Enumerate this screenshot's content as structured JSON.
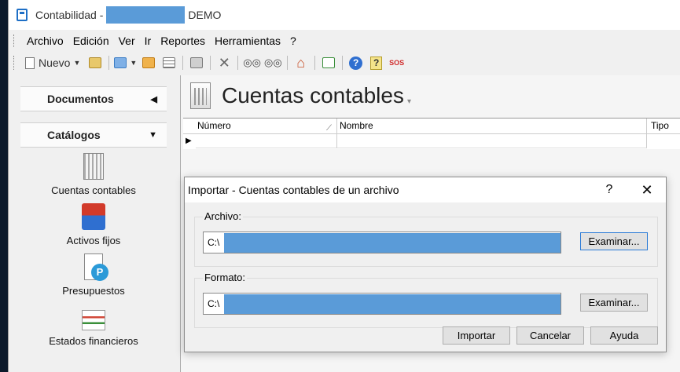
{
  "window": {
    "title_prefix": "Contabilidad -",
    "title_suffix": "DEMO"
  },
  "menu": [
    "Archivo",
    "Edición",
    "Ver",
    "Ir",
    "Reportes",
    "Herramientas",
    "?"
  ],
  "toolbar": {
    "new_label": "Nuevo",
    "sos_label": "SOS"
  },
  "sidebar": {
    "documents_header": "Documentos",
    "catalogs_header": "Catálogos",
    "items": [
      {
        "label": "Cuentas contables",
        "icon": "ledger-icon"
      },
      {
        "label": "Activos fijos",
        "icon": "truck-icon"
      },
      {
        "label": "Presupuestos",
        "icon": "budget-icon"
      },
      {
        "label": "Estados financieros",
        "icon": "financial-statements-icon"
      }
    ]
  },
  "main": {
    "title": "Cuentas contables",
    "columns": [
      "Número",
      "Nombre",
      "Tipo"
    ]
  },
  "dialog": {
    "title": "Importar - Cuentas contables de un archivo",
    "help": "?",
    "close": "✕",
    "archivo_label": "Archivo:",
    "archivo_value": "C:\\",
    "formato_label": "Formato:",
    "formato_value": "C:\\",
    "browse_label": "Examinar...",
    "import_label": "Importar",
    "cancel_label": "Cancelar",
    "help_label": "Ayuda"
  },
  "colors": {
    "redaction": "#5a9bd8",
    "accent_blue": "#1e6fc6"
  }
}
